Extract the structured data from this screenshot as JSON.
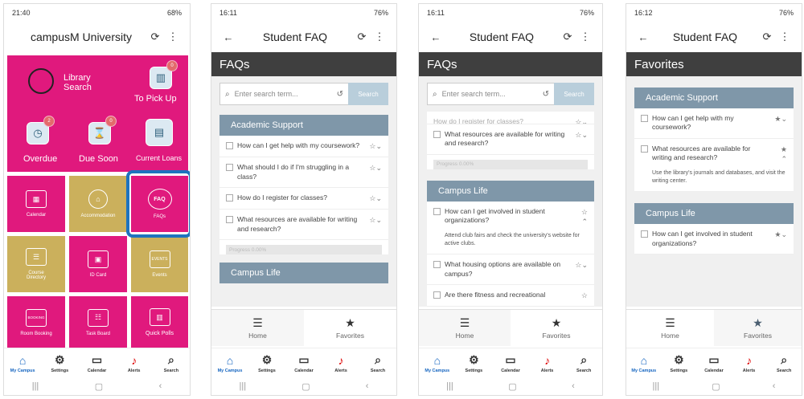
{
  "phones": [
    {
      "status": {
        "time": "21:40",
        "right": "68%"
      },
      "header": {
        "title": "campusM University"
      },
      "top_tiles": [
        {
          "label": "Library Search"
        },
        {
          "label": "To Pick Up",
          "badge": "0"
        },
        {
          "label": "Overdue",
          "badge": "2"
        },
        {
          "label": "Due Soon",
          "badge": "0"
        },
        {
          "label": "Current Loans"
        }
      ],
      "tiles": [
        {
          "label": "Calendar"
        },
        {
          "label": "Accommodation"
        },
        {
          "label": "FAQs",
          "icon": "FAQ"
        },
        {
          "label": "Course Directory"
        },
        {
          "label": "ID Card"
        },
        {
          "label": "Events",
          "icon": "EVENTS"
        },
        {
          "label": "Room Booking",
          "icon": "BOOKING"
        },
        {
          "label": "Task Board"
        },
        {
          "label": "Quick Polls"
        }
      ]
    },
    {
      "status": {
        "time": "16:11",
        "right": "76%"
      },
      "header": {
        "title": "Student FAQ"
      },
      "bar_title": "FAQs"
    },
    {
      "status": {
        "time": "16:11",
        "right": "76%"
      },
      "header": {
        "title": "Student FAQ"
      },
      "bar_title": "FAQs"
    },
    {
      "status": {
        "time": "16:12",
        "right": "76%"
      },
      "header": {
        "title": "Student FAQ"
      },
      "bar_title": "Favorites"
    }
  ],
  "search": {
    "placeholder": "Enter search term...",
    "button": "Search"
  },
  "categories": {
    "academic": "Academic Support",
    "campus": "Campus Life"
  },
  "questions": {
    "coursework": "How can I get help with my coursework?",
    "struggling": "What should I do if I'm struggling in a class?",
    "register": "How do I register for classes?",
    "writing": "What resources are available for writing and research?",
    "involved": "How can I get involved in student organizations?",
    "housing": "What housing options are available on campus?",
    "fitness": "Are there fitness and recreational"
  },
  "answers": {
    "involved": "Attend club fairs and check the university's website for active clubs.",
    "writing": "Use the library's journals and databases, and visit the writing center."
  },
  "progress": "Progress 0.00%",
  "tabs": {
    "home": "Home",
    "favorites": "Favorites"
  },
  "nav": {
    "campus": "My Campus",
    "settings": "Settings",
    "calendar": "Calendar",
    "alerts": "Alerts",
    "search": "Search"
  },
  "colors": {
    "pink": "#e0197d",
    "gold": "#cbb05c",
    "category": "#7f97a9",
    "highlight": "#1e73be"
  }
}
